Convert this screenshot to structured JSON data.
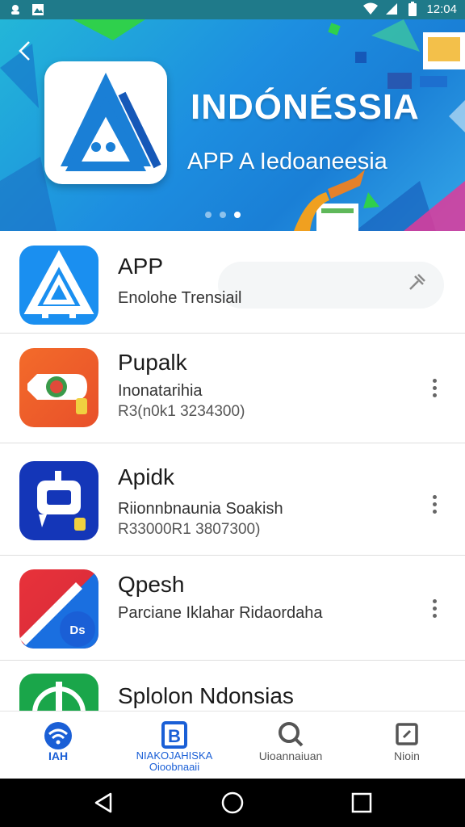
{
  "status_bar": {
    "time": "12:04",
    "icons": [
      "face-notification-icon",
      "image-notification-icon",
      "wifi-icon",
      "signal-icon",
      "battery-icon"
    ]
  },
  "banner": {
    "title": "INDÓNÉSSIA",
    "subtitle": "APP A Iedoaneesia",
    "back_icon": "chevron-left-icon",
    "slides": 3,
    "active_slide": 3
  },
  "apps": [
    {
      "name": "APP",
      "description": "Enolohe Trensiail",
      "meta": "",
      "accent": "#1a8ff0",
      "action_icon": "pin-icon"
    },
    {
      "name": "Pupalk",
      "description": "Inonatarihia",
      "meta": "R3(n0k1 3234300)",
      "accent": "#f0662a",
      "action_icon": "more-vertical-icon"
    },
    {
      "name": "Apidk",
      "description": "Riionnbnaunia Soakish",
      "meta": "R33000R1 3807300)",
      "accent": "#1436b8",
      "action_icon": "more-vertical-icon"
    },
    {
      "name": "Qpesh",
      "description": "Parciane Iklahar Ridaordaha",
      "meta": "",
      "accent": "#e8323a",
      "action_icon": "more-vertical-icon"
    },
    {
      "name": "Splolon Ndonsias",
      "description": "",
      "meta": "",
      "accent": "#1aa64a",
      "action_icon": ""
    }
  ],
  "bottom_nav": [
    {
      "label": "IAH",
      "icon": "wifi-home-icon",
      "active": true
    },
    {
      "label": "NIAKOJAHISKA Oioobnaaii",
      "icon": "b-app-icon",
      "active": false
    },
    {
      "label": "Uioannaiuan",
      "icon": "search-icon",
      "active": false
    },
    {
      "label": "Nioin",
      "icon": "square-app-icon",
      "active": false
    }
  ],
  "colors": {
    "accent": "#1a7fd6",
    "status_bar": "#1f7a8a",
    "active_nav": "#1a5fd6"
  },
  "system_nav": [
    "back-icon",
    "home-icon",
    "recents-icon"
  ]
}
